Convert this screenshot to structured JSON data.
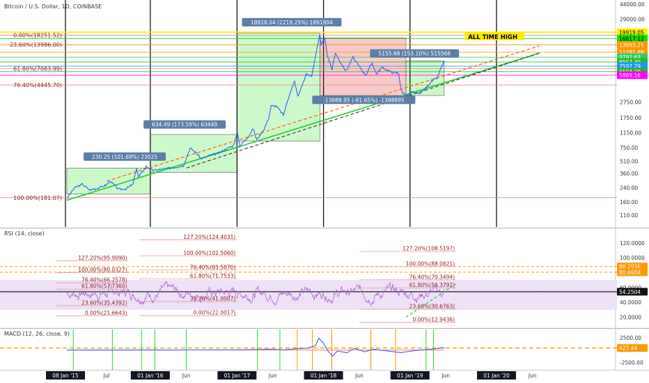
{
  "colors": {
    "price": "#2962ff",
    "support": "#22cc22",
    "dashed_orange": "#ff6d00",
    "dashed_black": "#333333",
    "rsi_line": "#a855c7",
    "rsi_band": "#ede0f7",
    "green_box": "#b7f7b3",
    "red_box": "#f6b2b2",
    "macd_line": "#2962ff",
    "signal_line": "#ff9800",
    "yellow": "#ffeb00",
    "magenta": "#e600e6",
    "fib": "#e08b8b",
    "axis_text": "#333333",
    "vline": "#111111"
  },
  "chart_data": [
    {
      "type": "line",
      "panel": "price",
      "title": "Bitcoin / U.S. Dollar, 1D, COINBASE",
      "scale": "log",
      "ylim": [
        85,
        46000
      ],
      "x_tick_labels": [
        "08 Jan '15",
        "Jul",
        "01 Jan '16",
        "Jun",
        "01 Jan '17",
        "Jun",
        "01 Jan '18",
        "Jun",
        "01 Jan '19",
        "Jun",
        "01 Jan '20",
        "Jun"
      ],
      "x_tick_dates": [
        "2015-01-08",
        "2015-07-01",
        "2016-01-01",
        "2016-06-01",
        "2017-01-01",
        "2017-06-01",
        "2018-01-01",
        "2018-06-01",
        "2019-01-01",
        "2019-06-01",
        "2020-01-01",
        "2020-06-01"
      ],
      "y_tick_labels": [
        "44000.00",
        "29000.00",
        "2750.00",
        "1750.00",
        "1150.00",
        "750.00",
        "510.00",
        "360.00",
        "240.00",
        "160.00",
        "110.00"
      ],
      "y_tick_values": [
        44000,
        29000,
        2750,
        1750,
        1150,
        750,
        510,
        360,
        240,
        160,
        110
      ],
      "price_tags": [
        {
          "label": "19919.05",
          "value": 19919.05,
          "color": "#ffeb00",
          "text": "#000000"
        },
        {
          "label": "16617.12",
          "value": 16617.12,
          "color": "#00e600",
          "text": "#000000"
        },
        {
          "label": "13893.25",
          "value": 13893.25,
          "color": "#ff9800",
          "text": "#ffffff"
        },
        {
          "label": "11281.88",
          "value": 11281.88,
          "color": "#ff9800",
          "text": "#ffffff"
        },
        {
          "label": "9792.63",
          "value": 9792.63,
          "color": "#33cc66",
          "text": "#ffffff"
        },
        {
          "label": "8557.30",
          "value": 8557.3,
          "color": "#22bb22",
          "text": "#ffffff"
        },
        {
          "label": "7597.29",
          "value": 7597.29,
          "color": "#2196f3",
          "text": "#ffffff"
        },
        {
          "label": "6504.29",
          "value": 6504.29,
          "color": "#22bb22",
          "text": "#ffffff"
        },
        {
          "label": "5869.16",
          "value": 5869.16,
          "color": "#ff00ff",
          "text": "#ffffff"
        }
      ],
      "fib_levels": [
        {
          "label": "0.00%(18251.52)",
          "value": 18251.52
        },
        {
          "label": "23.60%(13986.00)",
          "value": 13986
        },
        {
          "label": "61.80%(7083.99)",
          "value": 7083.99
        },
        {
          "label": "76.40%(4445.70)",
          "value": 4445.7
        },
        {
          "label": "100.00%(181.07)",
          "value": 181.07
        }
      ],
      "annotations": [
        {
          "text": "230.25 (101.69%) 23025",
          "date": "2015-09-15",
          "value": 570
        },
        {
          "text": "634.49 (173.59%) 63449",
          "date": "2016-05-25",
          "value": 1420
        },
        {
          "text": "18918.04 (2219.25%) 1891804",
          "date": "2017-08-20",
          "value": 26000
        },
        {
          "text": "5155.68 (153.10%) 515568",
          "date": "2019-01-20",
          "value": 10700
        },
        {
          "text": "-13888.95 (-81.65%) -1388895",
          "date": "2018-06-20",
          "value": 2860
        },
        {
          "text": "ALL TIME HIGH",
          "date": "2019-12-15",
          "value": 17500
        }
      ],
      "boxes": [
        {
          "kind": "gain",
          "x0": "2015-01-14",
          "x1": "2016-01-01",
          "y0": 200,
          "y1": 420
        },
        {
          "kind": "gain",
          "x0": "2016-01-01",
          "x1": "2017-01-01",
          "y0": 370,
          "y1": 1090
        },
        {
          "kind": "gain",
          "x0": "2017-01-01",
          "x1": "2017-12-17",
          "y0": 900,
          "y1": 19500
        },
        {
          "kind": "loss",
          "x0": "2017-12-17",
          "x1": "2018-12-15",
          "y0": 3300,
          "y1": 17000
        },
        {
          "kind": "gain",
          "x0": "2018-12-15",
          "x1": "2019-05-25",
          "y0": 3300,
          "y1": 8800
        }
      ],
      "support_line": [
        [
          "2015-01-14",
          168
        ],
        [
          "2020-06-30",
          11000
        ]
      ],
      "dashed_orange_line": [
        [
          "2015-07-01",
          290
        ],
        [
          "2020-06-30",
          13500
        ]
      ],
      "dashed_black_line": [
        [
          "2016-06-01",
          420
        ],
        [
          "2020-06-30",
          11000
        ]
      ],
      "series": [
        {
          "points": [
            [
              "2015-01-14",
              178
            ],
            [
              "2015-02-15",
              238
            ],
            [
              "2015-03-20",
              265
            ],
            [
              "2015-04-20",
              225
            ],
            [
              "2015-05-25",
              237
            ],
            [
              "2015-06-30",
              260
            ],
            [
              "2015-07-15",
              290
            ],
            [
              "2015-08-20",
              230
            ],
            [
              "2015-09-20",
              232
            ],
            [
              "2015-10-20",
              265
            ],
            [
              "2015-11-04",
              420
            ],
            [
              "2015-11-12",
              325
            ],
            [
              "2015-12-15",
              440
            ],
            [
              "2016-01-15",
              390
            ],
            [
              "2016-02-15",
              405
            ],
            [
              "2016-03-15",
              415
            ],
            [
              "2016-04-15",
              430
            ],
            [
              "2016-05-20",
              450
            ],
            [
              "2016-06-17",
              740
            ],
            [
              "2016-07-10",
              655
            ],
            [
              "2016-08-03",
              550
            ],
            [
              "2016-09-15",
              610
            ],
            [
              "2016-10-15",
              640
            ],
            [
              "2016-11-15",
              720
            ],
            [
              "2016-12-15",
              790
            ],
            [
              "2017-01-04",
              1140
            ],
            [
              "2017-01-12",
              780
            ],
            [
              "2017-02-20",
              1050
            ],
            [
              "2017-03-10",
              1290
            ],
            [
              "2017-03-25",
              940
            ],
            [
              "2017-04-25",
              1270
            ],
            [
              "2017-05-15",
              1750
            ],
            [
              "2017-05-25",
              2450
            ],
            [
              "2017-06-15",
              2450
            ],
            [
              "2017-07-16",
              1900
            ],
            [
              "2017-08-10",
              3400
            ],
            [
              "2017-09-01",
              4900
            ],
            [
              "2017-09-15",
              3200
            ],
            [
              "2017-10-20",
              6000
            ],
            [
              "2017-11-12",
              5800
            ],
            [
              "2017-11-28",
              9800
            ],
            [
              "2017-12-17",
              19100
            ],
            [
              "2017-12-22",
              13500
            ],
            [
              "2018-01-06",
              17100
            ],
            [
              "2018-01-17",
              10500
            ],
            [
              "2018-02-06",
              6900
            ],
            [
              "2018-02-20",
              11100
            ],
            [
              "2018-03-15",
              8300
            ],
            [
              "2018-04-06",
              6600
            ],
            [
              "2018-05-05",
              9800
            ],
            [
              "2018-06-01",
              7500
            ],
            [
              "2018-06-28",
              5900
            ],
            [
              "2018-07-25",
              8300
            ],
            [
              "2018-08-12",
              6100
            ],
            [
              "2018-09-05",
              7300
            ],
            [
              "2018-10-15",
              6400
            ],
            [
              "2018-11-14",
              6200
            ],
            [
              "2018-11-25",
              3800
            ],
            [
              "2018-12-15",
              3230
            ],
            [
              "2019-01-10",
              3650
            ],
            [
              "2019-02-08",
              3450
            ],
            [
              "2019-03-01",
              3850
            ],
            [
              "2019-04-02",
              4950
            ],
            [
              "2019-04-25",
              5400
            ],
            [
              "2019-05-12",
              7200
            ],
            [
              "2019-05-18",
              7900
            ],
            [
              "2019-05-27",
              8750
            ]
          ]
        }
      ]
    },
    {
      "type": "line",
      "panel": "rsi",
      "title": "RSI (14, close)",
      "ylim": [
        10,
        135
      ],
      "y_tick_labels": [
        "120.0000",
        "100.0000",
        "80.0000",
        "60.0000",
        "40.0000",
        "20.0000"
      ],
      "y_tick_values": [
        120,
        100,
        80,
        60,
        40,
        20
      ],
      "value_tags": [
        {
          "label": "88.2936",
          "value": 88.2936,
          "color": "#ff9800"
        },
        {
          "label": "80.6604",
          "value": 80.6604,
          "color": "#ff9800"
        },
        {
          "label": "54.2504",
          "value": 54.2504,
          "color": "#111111"
        }
      ],
      "band": [
        30,
        70
      ],
      "horizontal_level": 54.25,
      "fib_levels": [
        {
          "label": "127.20%(95.9090)",
          "value": 95.909,
          "x0": "2014-12-01",
          "x1": "2015-10-01"
        },
        {
          "label": "100.00%(80.0327)",
          "value": 80.0327,
          "x0": "2014-12-01",
          "x1": "2015-10-01"
        },
        {
          "label": "76.40%(66.2578)",
          "value": 66.2578,
          "x0": "2014-12-01",
          "x1": "2015-10-01"
        },
        {
          "label": "61.80%(57.7360)",
          "value": 57.736,
          "x0": "2014-12-01",
          "x1": "2015-10-01"
        },
        {
          "label": "23.60%(35.4392)",
          "value": 35.4392,
          "x0": "2014-12-01",
          "x1": "2015-10-01"
        },
        {
          "label": "0.00%(21.6643)",
          "value": 21.6643,
          "x0": "2014-12-01",
          "x1": "2015-10-01"
        },
        {
          "label": "127.20%(124.4031)",
          "value": 124.4031,
          "x0": "2015-11-15",
          "x1": "2017-01-01"
        },
        {
          "label": "100.00%(102.5060)",
          "value": 102.506,
          "x0": "2015-11-15",
          "x1": "2017-01-01"
        },
        {
          "label": "76.40%(83.5070)",
          "value": 83.507,
          "x0": "2015-11-15",
          "x1": "2017-01-01"
        },
        {
          "label": "61.80%(71.7533)",
          "value": 71.7533,
          "x0": "2015-11-15",
          "x1": "2017-01-01"
        },
        {
          "label": "38.20%(41.0007)",
          "value": 41.0007,
          "x0": "2015-11-15",
          "x1": "2017-01-01"
        },
        {
          "label": "0.00%(22.0017)",
          "value": 22.0017,
          "x0": "2015-11-15",
          "x1": "2017-01-01"
        },
        {
          "label": "127.20%(108.5197)",
          "value": 108.5197,
          "x0": "2018-06-01",
          "x1": "2019-07-15"
        },
        {
          "label": "100.00%(88.0821)",
          "value": 88.0821,
          "x0": "2018-06-01",
          "x1": "2019-07-15"
        },
        {
          "label": "76.40%(70.3494)",
          "value": 70.3494,
          "x0": "2018-06-01",
          "x1": "2019-07-15"
        },
        {
          "label": "61.80%(59.3792)",
          "value": 59.3792,
          "x0": "2018-06-01",
          "x1": "2019-07-15"
        },
        {
          "label": "23.60%(30.6763)",
          "value": 30.6763,
          "x0": "2018-06-01",
          "x1": "2019-07-15"
        },
        {
          "label": "0.00%(12.9436)",
          "value": 12.9436,
          "x0": "2018-06-01",
          "x1": "2019-07-15"
        }
      ],
      "series": [
        {
          "seed": 7,
          "start": "2015-01-14",
          "end": "2019-05-27",
          "mean": 53,
          "amplitude": 16
        }
      ]
    },
    {
      "type": "line",
      "panel": "macd",
      "title": "MACD (12, 26, close, 9)",
      "ylim": [
        -3600,
        3800
      ],
      "y_tick_labels": [
        "2500.00",
        "0.00",
        "-2500.00"
      ],
      "y_tick_values": [
        2500,
        0,
        -2500
      ],
      "value_tags": [
        {
          "label": "427.44",
          "value": 427.44,
          "color": "#ff9800"
        }
      ],
      "signal_level": 0,
      "green_markers": [
        "2015-02-10",
        "2015-07-25",
        "2015-11-25",
        "2016-01-20",
        "2016-06-01",
        "2017-03-28",
        "2017-07-01",
        "2019-03-10",
        "2019-04-10"
      ],
      "orange_markers": [
        "2017-09-12",
        "2017-11-15",
        "2018-02-05",
        "2018-07-20",
        "2018-11-01"
      ],
      "series": [
        {
          "name": "MACD",
          "points": [
            [
              "2015-01-14",
              -5
            ],
            [
              "2015-06-01",
              5
            ],
            [
              "2016-01-01",
              8
            ],
            [
              "2016-06-15",
              25
            ],
            [
              "2017-01-01",
              40
            ],
            [
              "2017-05-25",
              170
            ],
            [
              "2017-07-16",
              50
            ],
            [
              "2017-09-01",
              260
            ],
            [
              "2017-10-25",
              380
            ],
            [
              "2017-11-28",
              900
            ],
            [
              "2017-12-12",
              2450
            ],
            [
              "2017-12-30",
              1500
            ],
            [
              "2018-01-20",
              -150
            ],
            [
              "2018-02-07",
              -1250
            ],
            [
              "2018-03-01",
              -200
            ],
            [
              "2018-04-10",
              -550
            ],
            [
              "2018-05-10",
              350
            ],
            [
              "2018-06-25",
              -350
            ],
            [
              "2018-08-01",
              180
            ],
            [
              "2018-09-15",
              -100
            ],
            [
              "2018-11-25",
              -520
            ],
            [
              "2018-12-20",
              -320
            ],
            [
              "2019-02-01",
              -60
            ],
            [
              "2019-04-05",
              200
            ],
            [
              "2019-05-20",
              480
            ],
            [
              "2019-05-27",
              427
            ]
          ]
        }
      ]
    }
  ]
}
